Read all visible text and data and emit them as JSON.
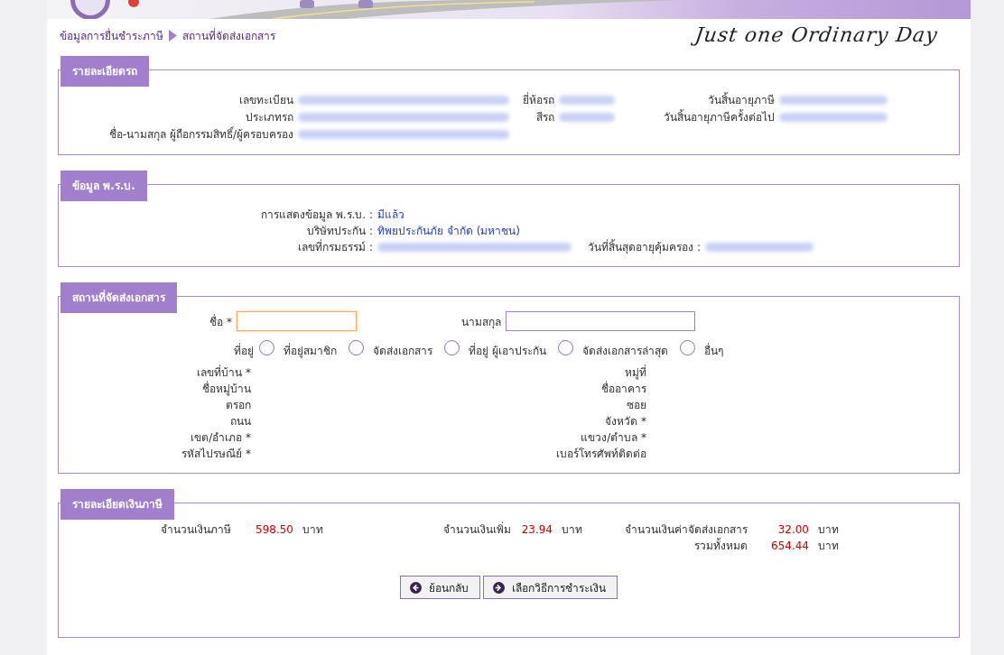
{
  "header": {
    "tagline": "Just one Ordinary Day"
  },
  "breadcrumb": [
    {
      "label": "ข้อมูลการยื่นชำระภาษี"
    },
    {
      "label": "สถานที่จัดส่งเอกสาร"
    }
  ],
  "vehicle_details": {
    "title": "รายละเอียดรถ",
    "rows": [
      [
        {
          "label": "เลขทะเบียน",
          "redacted": true
        },
        {
          "label": "ยี่ห้อรถ",
          "redacted": true
        },
        {
          "label": "วันสิ้นอายุภาษี",
          "redacted": true
        }
      ],
      [
        {
          "label": "ประเภทรถ",
          "redacted": true
        },
        {
          "label": "สีรถ",
          "redacted": true
        },
        {
          "label": "วันสิ้นอายุภาษีครั้งต่อไป",
          "redacted": true
        }
      ],
      [
        {
          "label": "ชื่อ-นามสกุล ผู้ถือกรรมสิทธิ์/ผู้ครอบครอง",
          "redacted": true
        }
      ]
    ]
  },
  "insurance": {
    "title": "ข้อมูล พ.ร.บ.",
    "rows": [
      [
        {
          "label": "การแสดงข้อมูล พ.ร.บ. :",
          "value": "มีแล้ว"
        }
      ],
      [
        {
          "label": "บริษัทประกัน :",
          "value": "ทิพยประกันภัย จำกัด (มหาชน)"
        }
      ],
      [
        {
          "label": "เลขที่กรมธรรม์ :",
          "redacted": true
        },
        {
          "label": "วันที่สิ้นสุดอายุคุ้มครอง :",
          "redacted": true
        }
      ]
    ]
  },
  "delivery": {
    "title": "สถานที่จัดส่งเอกสาร",
    "first_name": {
      "label": "ชื่อ *",
      "focused": true
    },
    "last_name": {
      "label": "นามสกุล",
      "focused": false
    },
    "address_label": "ที่อยู่",
    "address_options": [
      {
        "label": "ที่อยู่สมาชิก",
        "selected": false
      },
      {
        "label": "จัดส่งเอกสาร",
        "selected": false
      },
      {
        "label": "ที่อยู่ ผู้เอาประกัน",
        "selected": false
      },
      {
        "label": "จัดส่งเอกสารล่าสุด",
        "selected": false
      },
      {
        "label": "อื่นๆ",
        "selected": false
      }
    ],
    "address_fields": [
      [
        "เลขที่บ้าน *",
        "หมู่ที่"
      ],
      [
        "ชื่อหมู่บ้าน",
        "ชื่ออาคาร"
      ],
      [
        "ตรอก",
        "ซอย"
      ],
      [
        "ถนน",
        "จังหวัด *"
      ],
      [
        "เขต/อำเภอ *",
        "แขวง/ตำบล *"
      ],
      [
        "รหัสไปรษณีย์ *",
        "เบอร์โทรศัพท์ติดต่อ"
      ]
    ]
  },
  "payment": {
    "title": "รายละเอียดเงินภาษี",
    "items": [
      {
        "label": "จำนวนเงินภาษี",
        "amount": "598.50",
        "unit": "บาท"
      },
      {
        "label": "จำนวนเงินเพิ่ม",
        "amount": "23.94",
        "unit": "บาท"
      },
      {
        "label": "จำนวนเงินค่าจัดส่งเอกสาร",
        "amount": "32.00",
        "unit": "บาท"
      }
    ],
    "total": {
      "label": "รวมทั้งหมด",
      "amount": "654.44",
      "unit": "บาท"
    }
  },
  "buttons": [
    {
      "label": "ย้อนกลับ",
      "kind": "back"
    },
    {
      "label": "เลือกวิธีการชำระเงิน",
      "kind": "next"
    }
  ]
}
